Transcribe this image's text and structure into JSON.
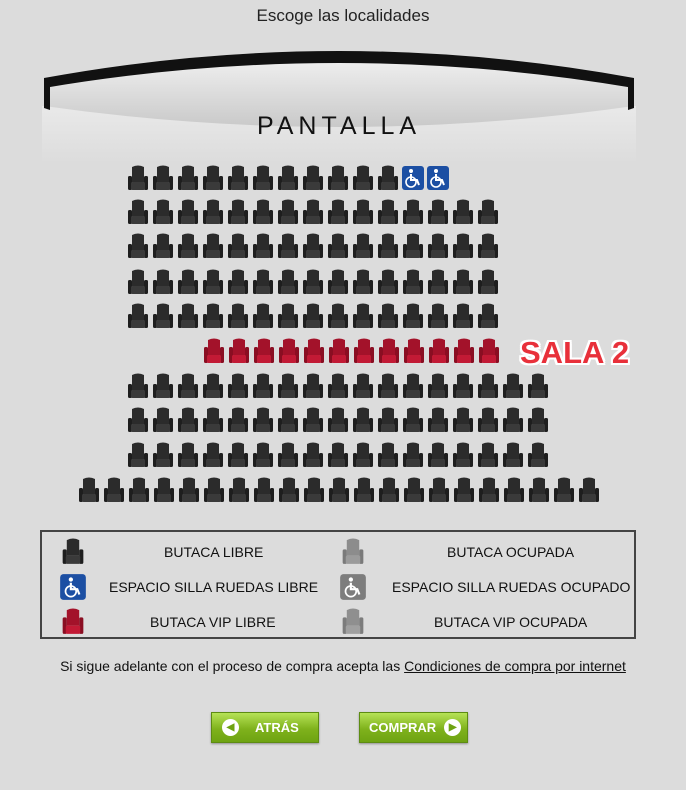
{
  "page": {
    "title": "Escoge las localidades"
  },
  "screen": {
    "label": "PANTALLA"
  },
  "hall": {
    "label": "SALA 2"
  },
  "seat_map": {
    "rows": [
      {
        "count": 11,
        "type": "libre",
        "accessible_extra": 2
      },
      {
        "count": 15,
        "type": "libre"
      },
      {
        "count": 15,
        "type": "libre"
      },
      {
        "count": 15,
        "type": "libre"
      },
      {
        "count": 15,
        "type": "libre"
      },
      {
        "count": 12,
        "type": "vip"
      },
      {
        "count": 17,
        "type": "libre"
      },
      {
        "count": 17,
        "type": "libre"
      },
      {
        "count": 17,
        "type": "libre"
      },
      {
        "count": 21,
        "type": "libre"
      }
    ]
  },
  "legend": {
    "items": [
      {
        "icon": "seat-free-icon",
        "label": "BUTACA LIBRE"
      },
      {
        "icon": "seat-occupied-icon",
        "label": "BUTACA OCUPADA"
      },
      {
        "icon": "wheelchair-free-icon",
        "label": "ESPACIO SILLA RUEDAS LIBRE"
      },
      {
        "icon": "wheelchair-occupied-icon",
        "label": "ESPACIO SILLA RUEDAS OCUPADO"
      },
      {
        "icon": "vip-seat-free-icon",
        "label": "BUTACA VIP LIBRE"
      },
      {
        "icon": "vip-seat-occupied-icon",
        "label": "BUTACA VIP OCUPADA"
      }
    ]
  },
  "terms": {
    "text": "Si sigue adelante con el proceso de compra acepta las ",
    "link": "Condiciones de compra por internet"
  },
  "buttons": {
    "back": "ATRÁS",
    "buy": "COMPRAR"
  },
  "colors": {
    "background": "#dcdcdc",
    "seat_free": "#2b2b2b",
    "seat_vip": "#a3122a",
    "seat_occupied": "#8c8c8c",
    "wheelchair": "#1c4fa3",
    "hall_label": "#e8303a",
    "button_green": "#7fb21c"
  }
}
